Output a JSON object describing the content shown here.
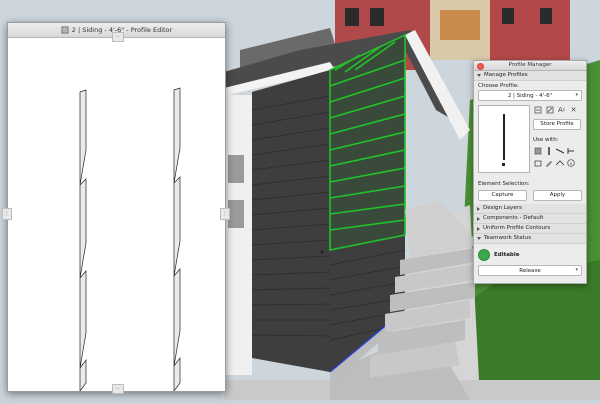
{
  "profile_editor": {
    "title": "2 | Siding - 4'-6\" - Profile Editor"
  },
  "profile_manager": {
    "title": "Profile Manager",
    "sections": {
      "manage_profiles": "Manage Profiles",
      "design_layers": "Design Layers",
      "components": "Components - Default",
      "uniform_contours": "Uniform Profile Contours",
      "teamwork_status": "Teamwork Status"
    },
    "choose_profile_label": "Choose Profile:",
    "selected_profile": "2 | Siding - 4'-6\"",
    "store_profile_button": "Store Profile",
    "use_with_label": "Use with:",
    "element_selection_label": "Element Selection:",
    "capture_button": "Capture",
    "apply_button": "Apply",
    "status_text": "Editable",
    "release_value": "Release",
    "status_color": "#3aa84a"
  },
  "colors": {
    "siding": "#3e3e3e",
    "selection_highlight": "#1fbf2a",
    "sky": "#c9d4dc",
    "grass": "#3f8a2a"
  }
}
